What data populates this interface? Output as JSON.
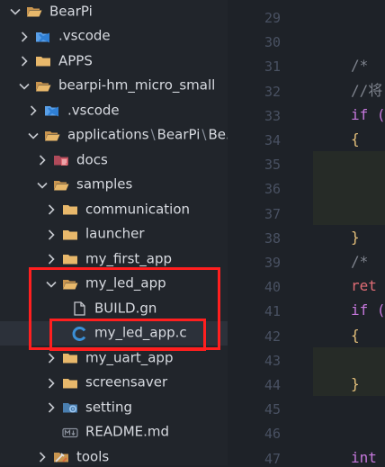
{
  "explorer": {
    "items": [
      {
        "label": "BearPi",
        "kind": "folder-open",
        "icon_name": "folder-open-icon"
      },
      {
        "label": ".vscode",
        "kind": "folder-closed",
        "icon_name": "vscode-folder-icon"
      },
      {
        "label": "APPS",
        "kind": "folder-closed",
        "icon_name": "folder-icon"
      },
      {
        "label": "bearpi-hm_micro_small",
        "kind": "folder-open",
        "icon_name": "folder-open-icon"
      },
      {
        "label": ".vscode",
        "kind": "folder-closed",
        "icon_name": "vscode-folder-icon"
      },
      {
        "label_parts": [
          "applications",
          "\\",
          "BearPi",
          "\\",
          "Be..."
        ],
        "kind": "folder-open",
        "icon_name": "folder-open-icon"
      },
      {
        "label": "docs",
        "kind": "folder-closed",
        "icon_name": "docs-folder-icon"
      },
      {
        "label": "samples",
        "kind": "folder-open",
        "icon_name": "folder-open-icon"
      },
      {
        "label": "communication",
        "kind": "folder-closed",
        "icon_name": "folder-icon"
      },
      {
        "label": "launcher",
        "kind": "folder-closed",
        "icon_name": "folder-icon"
      },
      {
        "label": "my_first_app",
        "kind": "folder-closed",
        "icon_name": "folder-icon"
      },
      {
        "label": "my_led_app",
        "kind": "folder-open",
        "icon_name": "folder-open-icon"
      },
      {
        "label": "BUILD.gn",
        "kind": "file",
        "icon_name": "file-icon"
      },
      {
        "label": "my_led_app.c",
        "kind": "file",
        "icon_name": "c-file-icon",
        "selected": true
      },
      {
        "label": "my_uart_app",
        "kind": "folder-closed",
        "icon_name": "folder-icon"
      },
      {
        "label": "screensaver",
        "kind": "folder-closed",
        "icon_name": "folder-icon"
      },
      {
        "label": "setting",
        "kind": "folder-closed",
        "icon_name": "settings-folder-icon"
      },
      {
        "label": "README.md",
        "kind": "file",
        "icon_name": "markdown-file-icon"
      },
      {
        "label": "tools",
        "kind": "folder-closed",
        "icon_name": "tools-folder-icon"
      }
    ]
  },
  "editor": {
    "line_numbers": [
      "29",
      "30",
      "31",
      "32",
      "33",
      "34",
      "35",
      "36",
      "37",
      "38",
      "39",
      "40",
      "41",
      "42",
      "43",
      "44",
      "45",
      "46",
      "47"
    ],
    "code_lines": [
      {
        "line": "31",
        "text": "/* ",
        "color": "#7f848e"
      },
      {
        "line": "32",
        "text": "//将",
        "color": "#7f848e"
      },
      {
        "line": "33",
        "text": "if (",
        "color": "#c678dd"
      },
      {
        "line": "34",
        "text": "{",
        "color": "#e5c07b"
      },
      {
        "line": "38",
        "text": "}",
        "color": "#e5c07b"
      },
      {
        "line": "39",
        "text": "/* ",
        "color": "#7f848e"
      },
      {
        "line": "40",
        "text": "ret",
        "color": "#e06c75"
      },
      {
        "line": "41",
        "text": "if (",
        "color": "#c678dd"
      },
      {
        "line": "42",
        "text": "{",
        "color": "#e5c07b"
      },
      {
        "line": "44",
        "text": "}",
        "color": "#e5c07b"
      },
      {
        "line": "47",
        "text": "int",
        "color": "#c678dd"
      }
    ]
  },
  "colors": {
    "highlight_box": "#ff1f1f",
    "folder": "#e8b86b",
    "c_icon": "#3b8fd6",
    "vscode_icon": "#2f7fd4"
  }
}
